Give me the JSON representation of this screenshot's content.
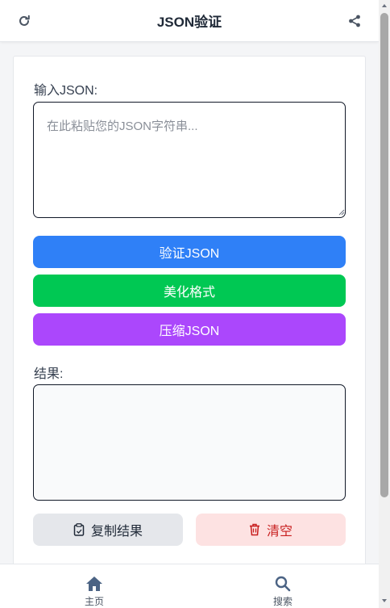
{
  "header": {
    "title": "JSON验证",
    "left_icon": "refresh-icon",
    "right_icon": "share-icon"
  },
  "input": {
    "label": "输入JSON:",
    "placeholder": "在此粘贴您的JSON字符串...",
    "value": ""
  },
  "buttons": {
    "validate": "验证JSON",
    "beautify": "美化格式",
    "compress": "压缩JSON",
    "copy": "复制结果",
    "clear": "清空"
  },
  "result": {
    "label": "结果:",
    "value": ""
  },
  "nav": {
    "items": [
      {
        "label": "主页",
        "icon": "home-icon"
      },
      {
        "label": "搜索",
        "icon": "search-icon"
      }
    ]
  },
  "colors": {
    "validate": "#2f80f7",
    "beautify": "#00c853",
    "compress": "#ab47fc",
    "clear_bg": "#fde2e2",
    "clear_text": "#c81e1e",
    "copy_bg": "#e5e7eb"
  }
}
